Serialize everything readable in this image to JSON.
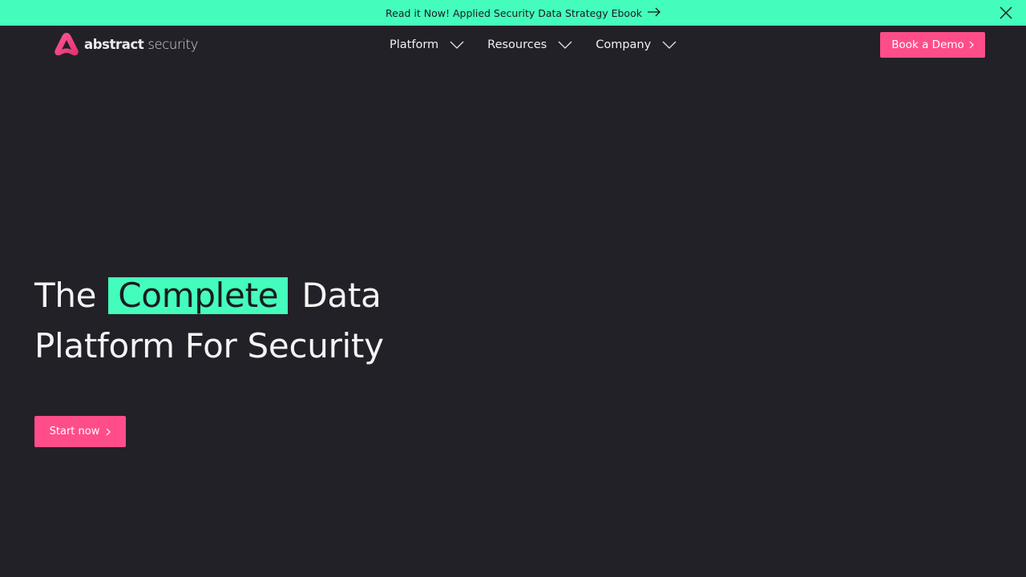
{
  "announcement": {
    "text": "Read it Now! Applied Security Data Strategy Ebook",
    "arrow_icon": "arrow-right-icon",
    "close_icon": "close-icon"
  },
  "brand": {
    "name_bold": "abstract",
    "name_light": "security",
    "logo_icon": "abstract-logo-icon"
  },
  "nav": {
    "items": [
      {
        "label": "Platform"
      },
      {
        "label": "Resources"
      },
      {
        "label": "Company"
      }
    ],
    "cta_label": "Book a Demo"
  },
  "hero": {
    "title_before": "The",
    "title_highlight": "Complete",
    "title_after": "Data",
    "title_line2": "Platform For Security",
    "cta_label": "Start now"
  },
  "colors": {
    "background": "#222127",
    "accent_green": "#44fdbc",
    "accent_pink": "#ff4d8a"
  }
}
